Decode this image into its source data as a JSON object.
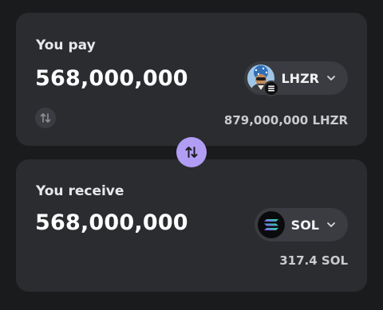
{
  "pay": {
    "label": "You pay",
    "amount": "568,000,000",
    "token": {
      "symbol": "LHZR",
      "icon": "lhzr-token-avatar",
      "badge_icon": "chain-badge-icon"
    },
    "balance": "879,000,000 LHZR",
    "flip_icon": "swap-arrows-icon"
  },
  "swap": {
    "icon": "swap-direction-icon",
    "color": "#b29df5"
  },
  "receive": {
    "label": "You receive",
    "amount": "568,000,000",
    "token": {
      "symbol": "SOL",
      "icon": "solana-logo-icon"
    },
    "balance": "317.4 SOL"
  },
  "colors": {
    "background": "#1a1b1d",
    "card": "#2a2c30",
    "pill": "#3a3c41",
    "accent": "#b29df5"
  }
}
